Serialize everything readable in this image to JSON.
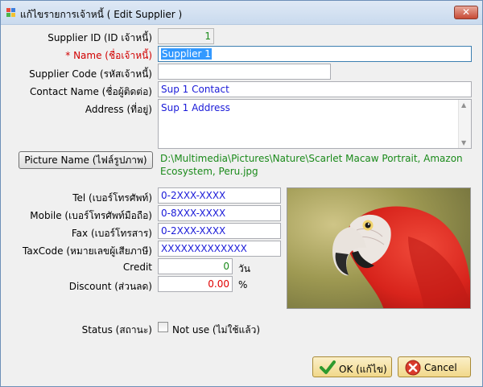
{
  "window": {
    "title": "แก้ไขรายการเจ้าหนี้ ( Edit Supplier )",
    "close_glyph": "✕"
  },
  "fields": {
    "supplier_id": {
      "label": "Supplier ID (ID เจ้าหนี้)",
      "value": "1"
    },
    "name": {
      "label_prefix": "* ",
      "label": "Name (ชื่อเจ้าหนี้)",
      "value": "Supplier 1"
    },
    "supplier_code": {
      "label": "Supplier Code (รหัสเจ้าหนี้)",
      "value": ""
    },
    "contact_name": {
      "label": "Contact Name (ชื่อผู้ติดต่อ)",
      "value": "Sup 1 Contact"
    },
    "address": {
      "label": "Address (ที่อยู่)",
      "value": "Sup 1 Address"
    },
    "picture": {
      "button_label": "Picture Name (ไฟล์รูปภาพ)",
      "path": "D:\\Multimedia\\Pictures\\Nature\\Scarlet Macaw Portrait, Amazon Ecosystem, Peru.jpg"
    },
    "tel": {
      "label": "Tel (เบอร์โทรศัพท์)",
      "value": "0-2XXX-XXXX"
    },
    "mobile": {
      "label": "Mobile (เบอร์โทรศัพท์มือถือ)",
      "value": "0-8XXX-XXXX"
    },
    "fax": {
      "label": "Fax (เบอร์โทรสาร)",
      "value": "0-2XXX-XXXX"
    },
    "taxcode": {
      "label": "TaxCode (หมายเลขผู้เสียภาษี)",
      "value": "XXXXXXXXXXXXX"
    },
    "credit": {
      "label": "Credit",
      "value": "0",
      "unit": "วัน"
    },
    "discount": {
      "label": "Discount (ส่วนลด)",
      "value": "0.00",
      "unit": "%"
    },
    "status": {
      "label": "Status (สถานะ)",
      "checkbox_label": "Not use (ไม่ใช้แล้ว)",
      "checked": false
    }
  },
  "buttons": {
    "ok": "OK (แก้ไข)",
    "cancel": "Cancel"
  },
  "colors": {
    "accent_selection": "#3399ff",
    "value_blue": "#1a1ad8",
    "value_green": "#1a8a1a",
    "required_red": "#d10000",
    "button_gold": "#f1d88a"
  },
  "icons": {
    "app": "app-icon",
    "close": "close-icon",
    "ok": "check-icon",
    "cancel": "cancel-icon",
    "scroll_up": "arrow-up-icon",
    "scroll_down": "arrow-down-icon"
  }
}
